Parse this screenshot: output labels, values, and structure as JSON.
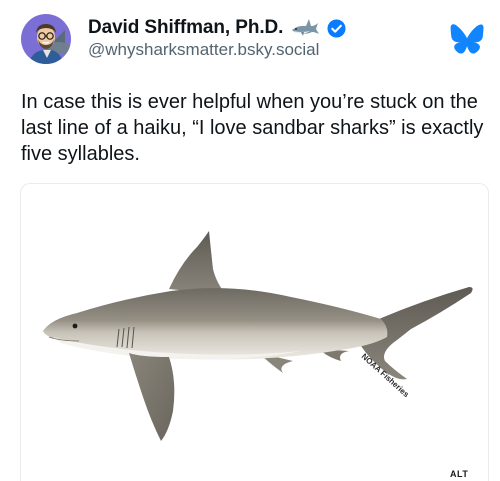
{
  "author": {
    "display_name": "David Shiffman, Ph.D.",
    "handle": "@whysharksmatter.bsky.social"
  },
  "post": {
    "text": "In case this is ever helpful when you’re stuck on the last line of a haiku, “I love sandbar sharks” is exactly five syllables."
  },
  "image": {
    "watermark": "NOAA Fisheries",
    "alt_badge": "ALT"
  },
  "icons": {
    "name_emoji": "shark-emoji",
    "verified": "verified-checkmark-icon",
    "platform": "bluesky-butterfly-icon"
  },
  "colors": {
    "text": "#0f1419",
    "secondary_text": "#536471",
    "verified_blue": "#0a7aff",
    "bluesky_blue": "#1185fe",
    "avatar_bg": "#7b6fd6"
  }
}
